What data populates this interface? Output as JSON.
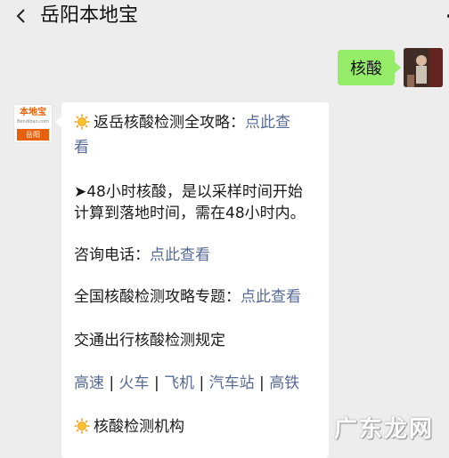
{
  "header": {
    "title": "岳阳本地宝",
    "back_icon": "chevron-left-icon"
  },
  "outgoing": {
    "text": "核酸",
    "bubble_color": "#95ec69"
  },
  "bot_avatar": {
    "logo_text": "本地宝",
    "logo_url": "Bendibao.com",
    "city": "岳阳",
    "accent": "#e8610a"
  },
  "message": {
    "line1_prefix": "返岳核酸检测全攻略：",
    "line1_link_a": "点此查",
    "line1_link_b": "看",
    "line2_a": "➤48小时核酸，是以采样时间开始",
    "line2_b": "计算到落地时间，需在48小时内。",
    "line3_prefix": "咨询电话：",
    "line3_link": "点此查看",
    "line4_prefix": "全国核酸检测攻略专题：",
    "line4_link": "点此查看",
    "line5": "交通出行核酸检测规定",
    "transport": [
      "高速",
      "火车",
      "飞机",
      "汽车站",
      "高铁"
    ],
    "separator": " | ",
    "line7": "核酸检测机构",
    "link_color": "#576b95"
  },
  "watermark": {
    "text": "广东龙网"
  }
}
